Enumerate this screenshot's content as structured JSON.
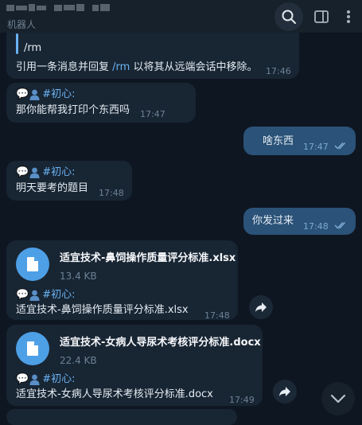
{
  "header": {
    "subtitle": "机器人"
  },
  "messages": {
    "m1": {
      "quote_line": "/rm",
      "text_before": "引用一条消息并回复 ",
      "cmd": "/rm",
      "text_after": " 以将其从远端会话中移除。",
      "time": "17:46"
    },
    "m2": {
      "sender": "#初心:",
      "text": "那你能帮我打印个东西吗",
      "time": "17:47"
    },
    "m3": {
      "text": "啥东西",
      "time": "17:47"
    },
    "m4": {
      "sender": "#初心:",
      "text": "明天要考的题目",
      "time": "17:48"
    },
    "m5": {
      "text": "你发过来",
      "time": "17:48"
    },
    "m6": {
      "file_name": "适宜技术-鼻饲操作质量评分标准.xlsx",
      "file_size": "13.4 KB",
      "sender": "#初心:",
      "caption": "适宜技术-鼻饲操作质量评分标准.xlsx",
      "time": "17:48"
    },
    "m7": {
      "file_name": "适宜技术-女病人导尿术考核评分标准.docx",
      "file_size": "22.4 KB",
      "sender": "#初心:",
      "caption": "适宜技术-女病人导尿术考核评分标准.docx",
      "time": "17:49"
    }
  },
  "colors": {
    "background": "#0e1621",
    "incoming_bubble": "#182533",
    "outgoing_bubble": "#2b5278",
    "accent": "#6ab2f2",
    "file_icon": "#4d9fe6"
  },
  "icons": [
    "search-icon",
    "sidebar-panel-icon",
    "more-vertical-icon",
    "file-icon",
    "share-arrow-icon",
    "chevron-down-icon",
    "double-check-icon",
    "speech-bubble-icon",
    "person-icon"
  ]
}
